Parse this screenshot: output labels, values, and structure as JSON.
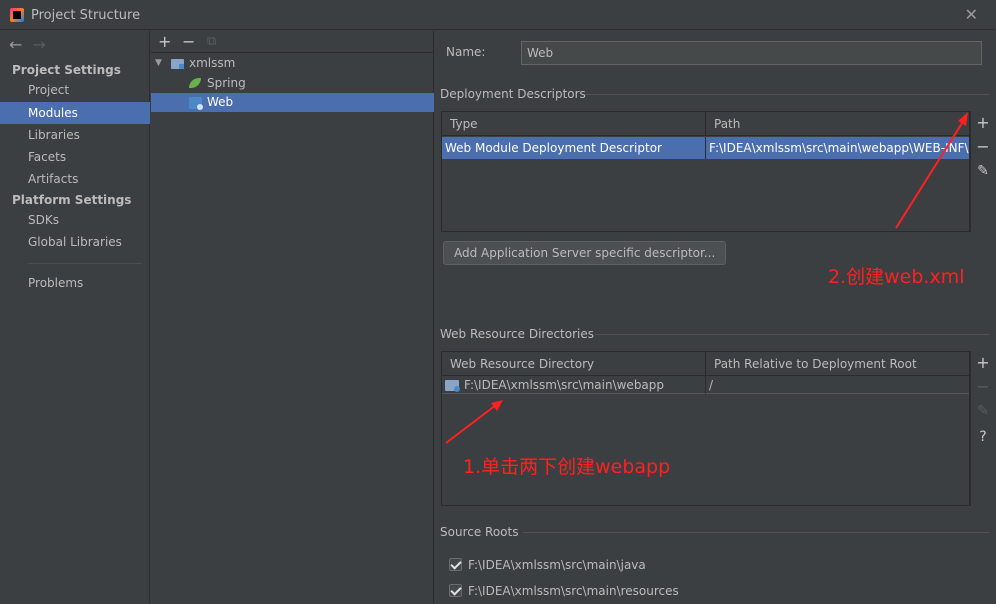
{
  "window": {
    "title": "Project Structure",
    "close_glyph": "✕"
  },
  "nav": {
    "back": "←",
    "forward": "→"
  },
  "sidebar": {
    "project_settings_header": "Project Settings",
    "project_items": [
      "Project",
      "Modules",
      "Libraries",
      "Facets",
      "Artifacts"
    ],
    "platform_settings_header": "Platform Settings",
    "platform_items": [
      "SDKs",
      "Global Libraries"
    ],
    "problems": "Problems",
    "selected": "Modules"
  },
  "tree_toolbar": {
    "add": "+",
    "remove": "−",
    "copy": "⧉"
  },
  "tree": {
    "root": "xmlssm",
    "children": [
      "Spring",
      "Web"
    ],
    "selected": "Web"
  },
  "main": {
    "name_label": "Name:",
    "name_value": "Web",
    "deployment": {
      "title": "Deployment Descriptors",
      "col_type": "Type",
      "col_path": "Path",
      "rows": [
        {
          "type": "Web Module Deployment Descriptor",
          "path": "F:\\IDEA\\xmlssm\\src\\main\\webapp\\WEB-INF\\web.xml"
        }
      ],
      "tools": {
        "add": "+",
        "remove": "−",
        "edit": "✎"
      },
      "add_server_button": "Add Application Server specific descriptor..."
    },
    "web_resources": {
      "title": "Web Resource Directories",
      "col_dir": "Web Resource Directory",
      "col_rel": "Path Relative to Deployment Root",
      "rows": [
        {
          "dir": "F:\\IDEA\\xmlssm\\src\\main\\webapp",
          "rel": "/"
        }
      ],
      "tools": {
        "add": "+",
        "remove": "−",
        "edit": "✎",
        "help": "?"
      }
    },
    "source_roots": {
      "title": "Source Roots",
      "items": [
        "F:\\IDEA\\xmlssm\\src\\main\\java",
        "F:\\IDEA\\xmlssm\\src\\main\\resources"
      ]
    }
  },
  "annotations": {
    "step2": "2.创建web.xml",
    "step1": "1.单击两下创建webapp",
    "color": "#ff2020"
  },
  "colors": {
    "selection": "#4b6eaf",
    "background": "#3c3f41"
  }
}
